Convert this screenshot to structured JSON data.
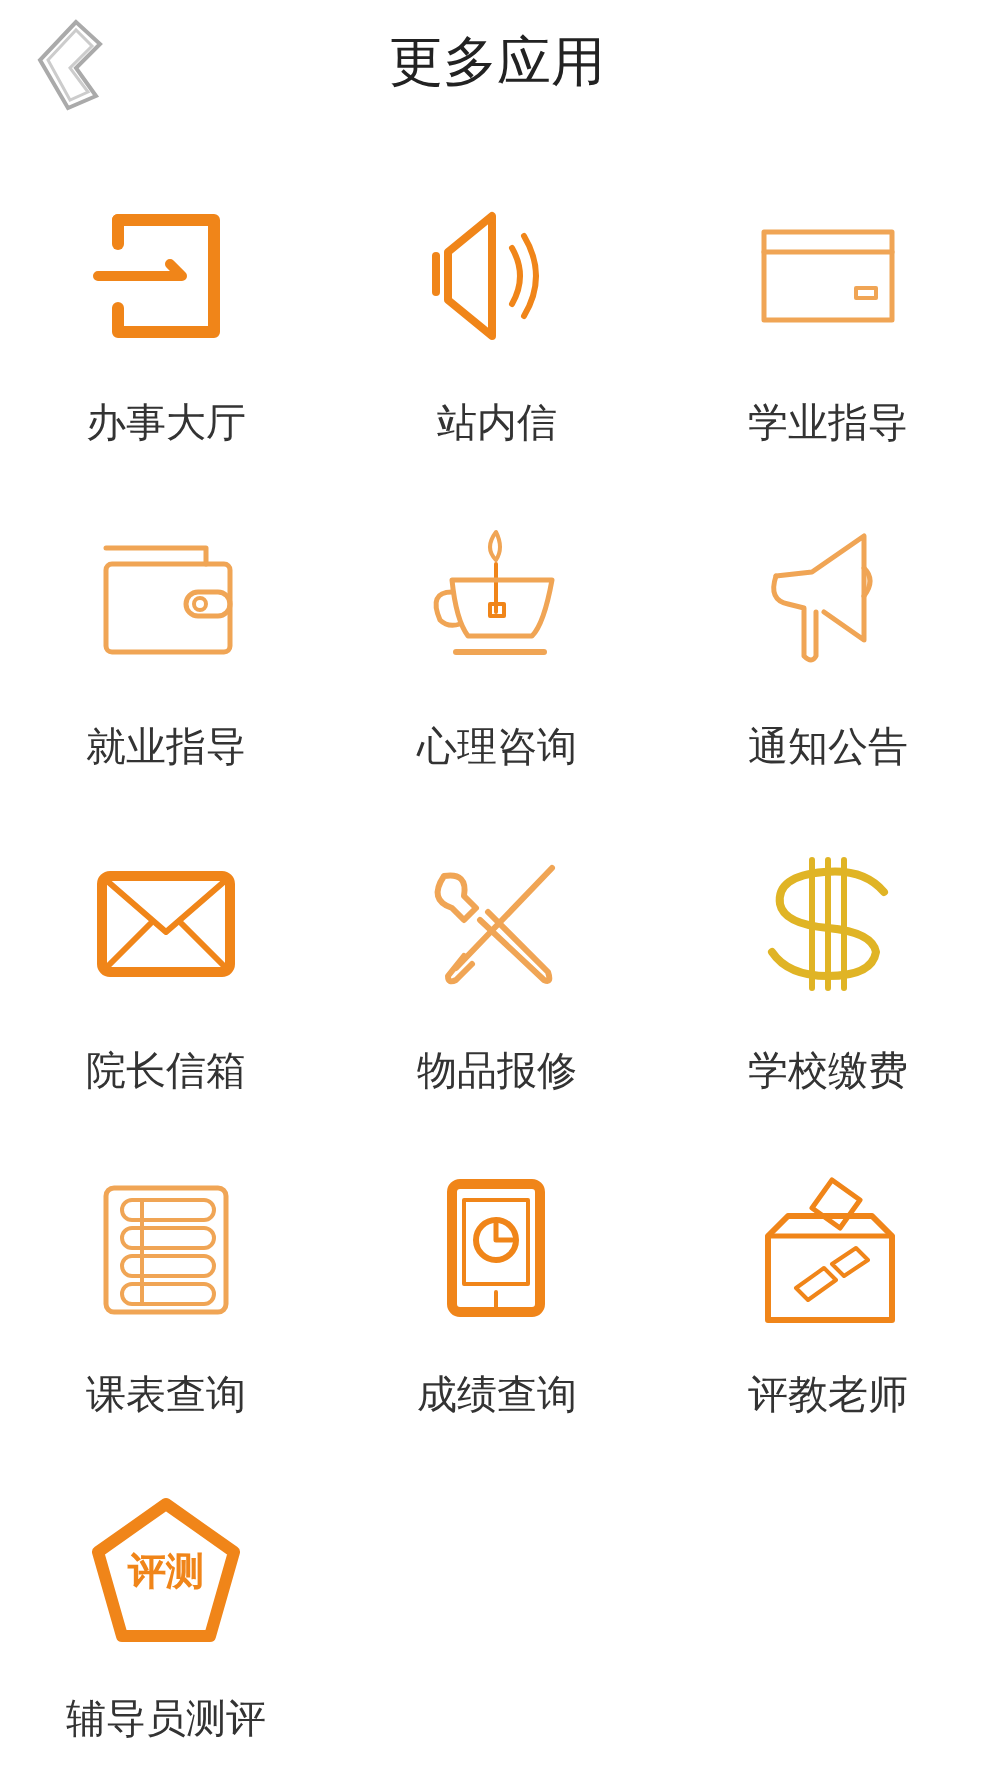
{
  "header": {
    "title": "更多应用"
  },
  "apps": [
    {
      "kind": "login",
      "label": "办事大厅"
    },
    {
      "kind": "speaker",
      "label": "站内信"
    },
    {
      "kind": "card",
      "label": "学业指导"
    },
    {
      "kind": "wallet",
      "label": "就业指导"
    },
    {
      "kind": "teacup",
      "label": "心理咨询"
    },
    {
      "kind": "megaphone",
      "label": "通知公告"
    },
    {
      "kind": "envelope",
      "label": "院长信箱"
    },
    {
      "kind": "tools",
      "label": "物品报修"
    },
    {
      "kind": "dollar",
      "label": "学校缴费"
    },
    {
      "kind": "list",
      "label": "课表查询"
    },
    {
      "kind": "tablet",
      "label": "成绩查询"
    },
    {
      "kind": "ballot",
      "label": "评教老师"
    },
    {
      "kind": "badge",
      "label": "辅导员测评",
      "icon_text": "评测"
    }
  ]
}
